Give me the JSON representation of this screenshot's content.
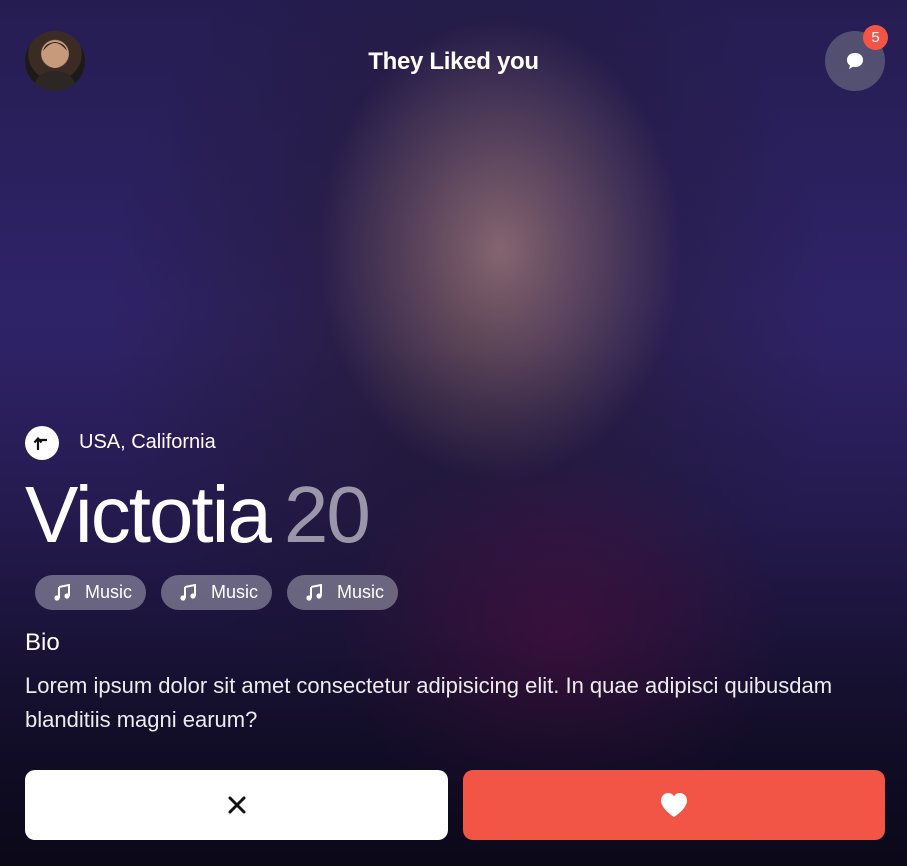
{
  "header": {
    "title": "They Liked you",
    "unread_count": "5"
  },
  "profile": {
    "location": "USA, California",
    "name": "Victotia",
    "age": "20",
    "interests": [
      {
        "label": "Music",
        "icon": "music-note-icon"
      },
      {
        "label": "Music",
        "icon": "music-note-icon"
      },
      {
        "label": "Music",
        "icon": "music-note-icon"
      }
    ],
    "bio_title": "Bio",
    "bio_text": "Lorem ipsum dolor sit amet consectetur adipisicing elit. In quae adipisci quibusdam blanditiis magni earum?"
  },
  "actions": {
    "dislike_icon": "close-icon",
    "like_icon": "heart-icon"
  },
  "colors": {
    "accent": "#f25445",
    "background": "#2f2368"
  }
}
